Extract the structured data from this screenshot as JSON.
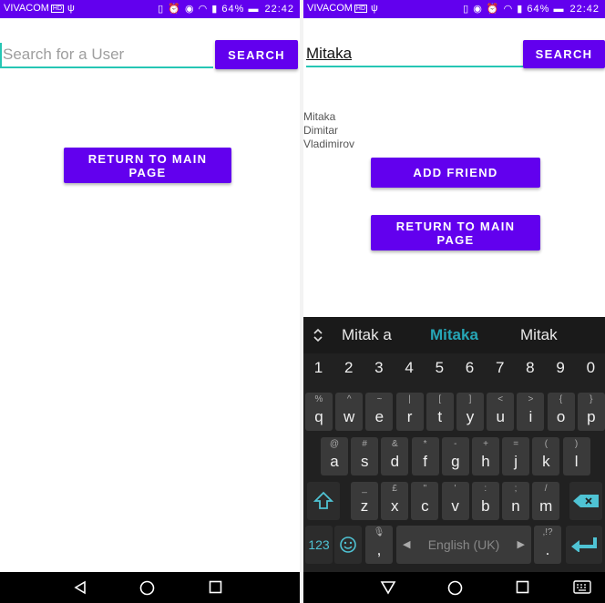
{
  "colors": {
    "accent": "#6200ee",
    "field_underline": "#26c6b4",
    "suggestion_highlight": "#26a6b6",
    "keyboard_bg": "#212121"
  },
  "status_bar": {
    "carrier": "VIVACOM",
    "network_badge": "HD",
    "battery": "64%",
    "time": "22:42"
  },
  "left_screen": {
    "search": {
      "placeholder": "Search for a User",
      "button": "SEARCH"
    },
    "return_button": "RETURN TO MAIN PAGE"
  },
  "right_screen": {
    "search": {
      "value": "Mitaka",
      "button": "SEARCH"
    },
    "result_user": "Mitaka Dimitar Vladimirov",
    "add_friend_button": "ADD FRIEND",
    "return_button": "RETURN TO MAIN PAGE"
  },
  "keyboard": {
    "suggestions": [
      "Mitak a",
      "Mitaka",
      "Mitak"
    ],
    "number_row": [
      "1",
      "2",
      "3",
      "4",
      "5",
      "6",
      "7",
      "8",
      "9",
      "0"
    ],
    "row1": [
      {
        "k": "q",
        "s": "%"
      },
      {
        "k": "w",
        "s": "^"
      },
      {
        "k": "e",
        "s": "~"
      },
      {
        "k": "r",
        "s": "|"
      },
      {
        "k": "t",
        "s": "["
      },
      {
        "k": "y",
        "s": "]"
      },
      {
        "k": "u",
        "s": "<"
      },
      {
        "k": "i",
        "s": ">"
      },
      {
        "k": "o",
        "s": "{"
      },
      {
        "k": "p",
        "s": "}"
      }
    ],
    "row2": [
      {
        "k": "a",
        "s": "@"
      },
      {
        "k": "s",
        "s": "#"
      },
      {
        "k": "d",
        "s": "&"
      },
      {
        "k": "f",
        "s": "*"
      },
      {
        "k": "g",
        "s": "-"
      },
      {
        "k": "h",
        "s": "+"
      },
      {
        "k": "j",
        "s": "="
      },
      {
        "k": "k",
        "s": "("
      },
      {
        "k": "l",
        "s": ")"
      }
    ],
    "row3": [
      {
        "k": "z",
        "s": "_"
      },
      {
        "k": "x",
        "s": "£"
      },
      {
        "k": "c",
        "s": "\""
      },
      {
        "k": "v",
        "s": "'"
      },
      {
        "k": "b",
        "s": ":"
      },
      {
        "k": "n",
        "s": ";"
      },
      {
        "k": "m",
        "s": "/"
      }
    ],
    "symbols_key": "123",
    "space_label": "English (UK)",
    "comma": ",",
    "period": ".",
    "period_alt": ",!?"
  },
  "icons": {
    "shift": "shift-icon",
    "backspace": "backspace-icon",
    "enter": "enter-icon",
    "emoji": "emoji-icon",
    "mic": "mic-icon",
    "back": "back-icon",
    "home": "home-icon",
    "recents": "recents-icon",
    "keyboard_switch": "keyboard-icon"
  }
}
